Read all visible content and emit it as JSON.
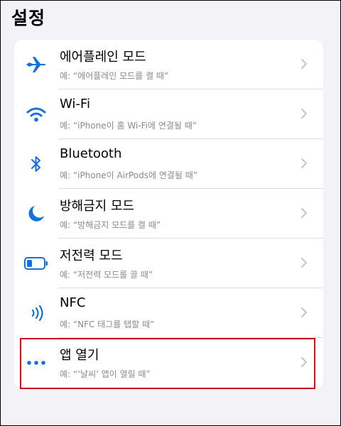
{
  "header": {
    "title": "설정"
  },
  "colors": {
    "accent": "#1670d9",
    "highlight": "#c8141e",
    "subtitle": "#8a8a8e"
  },
  "items": [
    {
      "title": "에어플레인 모드",
      "subtitle": "예: “에어플레인 모드를 켤 때”",
      "icon": "airplane-icon"
    },
    {
      "title": "Wi-Fi",
      "subtitle": "예: “iPhone이 홈 Wi-Fi에 연결될 때”",
      "icon": "wifi-icon"
    },
    {
      "title": "Bluetooth",
      "subtitle": "예: “iPhone이 AirPods에 연결될 때”",
      "icon": "bluetooth-icon"
    },
    {
      "title": "방해금지 모드",
      "subtitle": "예: “방해금지 모드를 켤 때”",
      "icon": "moon-icon"
    },
    {
      "title": "저전력 모드",
      "subtitle": "예: “저전력 모드를 끌 때”",
      "icon": "battery-icon"
    },
    {
      "title": "NFC",
      "subtitle": "예: “NFC 태그를 탭할 때”",
      "icon": "nfc-icon"
    },
    {
      "title": "앱 열기",
      "subtitle": "예: “‘날씨’ 앱이 열릴 때”",
      "icon": "ellipsis-icon",
      "highlighted": true
    }
  ]
}
